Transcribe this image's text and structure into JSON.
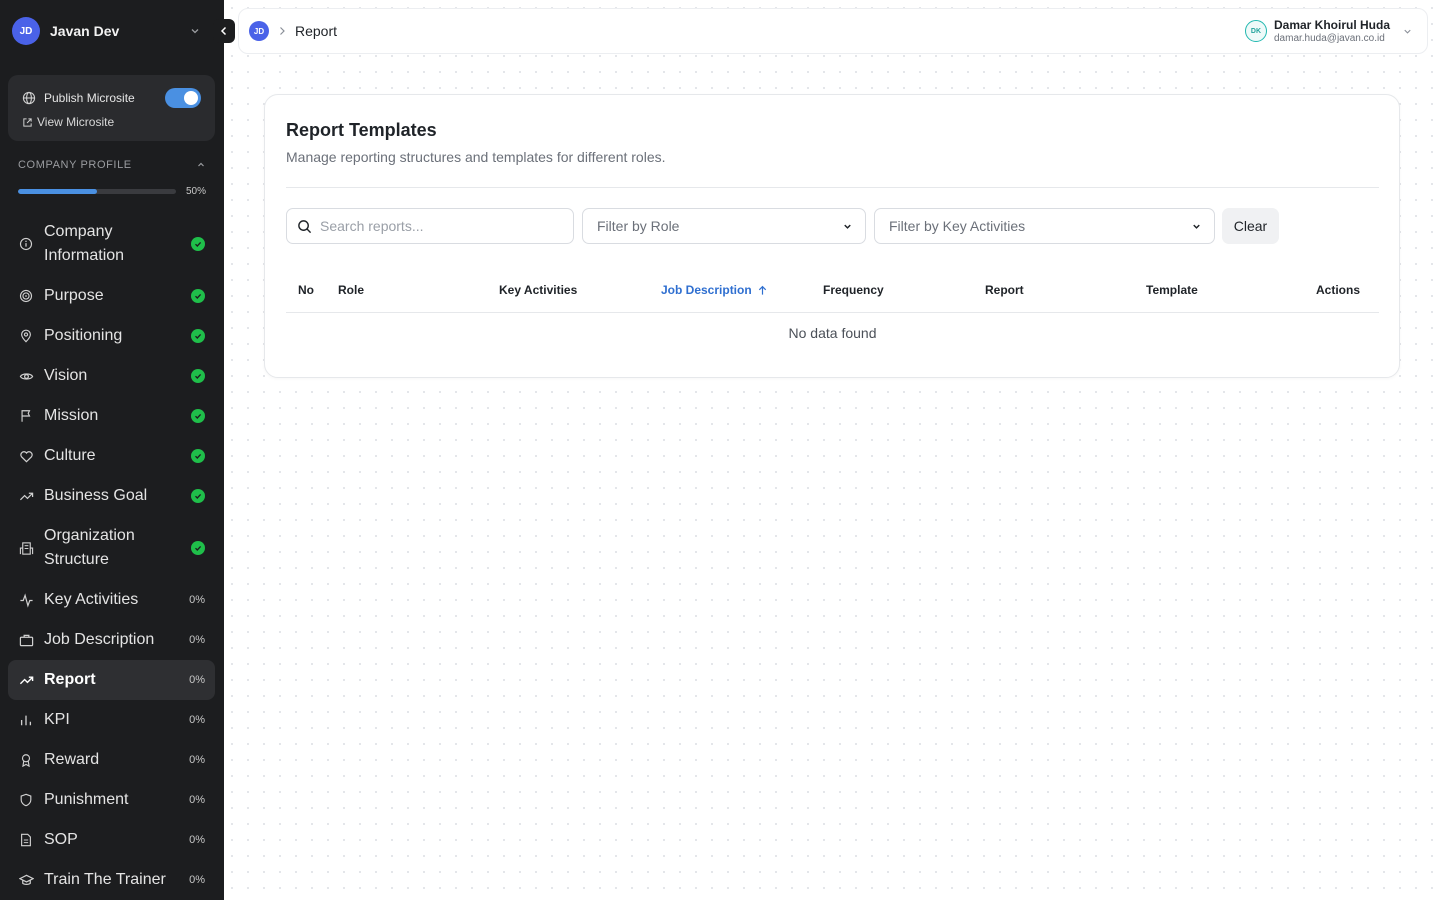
{
  "workspace": {
    "initials": "JD",
    "name": "Javan Dev"
  },
  "microsite": {
    "publish_label": "Publish Microsite",
    "publish_enabled": true,
    "view_label": "View Microsite"
  },
  "company_profile": {
    "title": "COMPANY PROFILE",
    "progress": 50,
    "progress_label": "50%"
  },
  "nav": [
    {
      "label": "Company Information",
      "icon": "info-icon",
      "status": "complete"
    },
    {
      "label": "Purpose",
      "icon": "target-icon",
      "status": "complete"
    },
    {
      "label": "Positioning",
      "icon": "map-pin-icon",
      "status": "complete"
    },
    {
      "label": "Vision",
      "icon": "eye-icon",
      "status": "complete"
    },
    {
      "label": "Mission",
      "icon": "flag-icon",
      "status": "complete"
    },
    {
      "label": "Culture",
      "icon": "heart-icon",
      "status": "complete"
    },
    {
      "label": "Business Goal",
      "icon": "trending-up-icon",
      "status": "complete"
    },
    {
      "label": "Organization Structure",
      "icon": "org-chart-icon",
      "status": "complete"
    },
    {
      "label": "Key Activities",
      "icon": "activity-icon",
      "status": "0%"
    },
    {
      "label": "Job Description",
      "icon": "briefcase-icon",
      "status": "0%"
    },
    {
      "label": "Report",
      "icon": "trending-up-icon",
      "status": "0%",
      "active": true
    },
    {
      "label": "KPI",
      "icon": "bar-chart-icon",
      "status": "0%"
    },
    {
      "label": "Reward",
      "icon": "award-icon",
      "status": "0%"
    },
    {
      "label": "Punishment",
      "icon": "shield-icon",
      "status": "0%"
    },
    {
      "label": "SOP",
      "icon": "document-icon",
      "status": "0%"
    },
    {
      "label": "Train The Trainer",
      "icon": "graduation-cap-icon",
      "status": "0%"
    }
  ],
  "topbar": {
    "crumb_initials": "JD",
    "crumb": "Report",
    "user": {
      "initials": "DK",
      "name": "Damar Khoirul Huda",
      "email": "damar.huda@javan.co.id"
    }
  },
  "page": {
    "title": "Report Templates",
    "subtitle": "Manage reporting structures and templates for different roles.",
    "search_placeholder": "Search reports...",
    "filter_role": "Filter by Role",
    "filter_activities": "Filter by Key Activities",
    "clear_label": "Clear",
    "columns": [
      "No",
      "Role",
      "Key Activities",
      "Job Description",
      "Frequency",
      "Report",
      "Template",
      "Actions"
    ],
    "sorted_column": "Job Description",
    "empty_text": "No data found"
  },
  "colors": {
    "accent": "#4a90e2",
    "success": "#1fbf4a",
    "sidebar_bg": "#1c1d1f",
    "link": "#2f6fd0"
  }
}
